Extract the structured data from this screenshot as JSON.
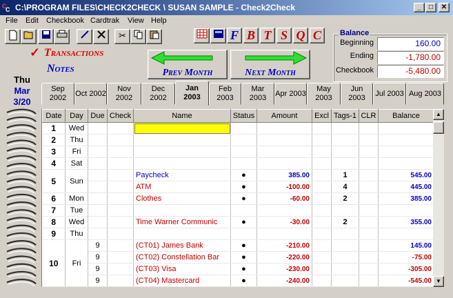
{
  "window": {
    "title": "C:\\PROGRAM FILES\\CHECK2CHECK \\ SUSAN SAMPLE - Check2Check",
    "min": "_",
    "max": "□",
    "close": "✕"
  },
  "menu": [
    "File",
    "Edit",
    "Checkbook",
    "Cardtrak",
    "View",
    "Help"
  ],
  "toolbar": {
    "new": "new-icon",
    "open": "open-icon",
    "save": "save-icon",
    "print": "print-icon",
    "pen": "pen-icon",
    "delete": "delete-icon",
    "cut": "scissors-icon",
    "copy": "copy-icon",
    "paste": "paste-icon"
  },
  "fbuttons": {
    "f": "F",
    "b": "B",
    "t": "T",
    "s": "S",
    "q": "Q",
    "c": "C"
  },
  "headings": {
    "transactions": "Transactions",
    "notes": "Notes",
    "check": "✓"
  },
  "calendar": {
    "dow": "Thu",
    "month": "Mar",
    "date": "3/20"
  },
  "nav": {
    "prev": "Prev Month",
    "next": "Next Month"
  },
  "balance": {
    "title": "Balance",
    "beginning_label": "Beginning",
    "beginning": "160.00",
    "ending_label": "Ending",
    "ending": "-1,780.00",
    "checkbook_label": "Checkbook",
    "checkbook": "-5,480.00"
  },
  "tabs": [
    "Sep 2002",
    "Oct 2002",
    "Nov\n2002",
    "Dec\n2002",
    "Jan\n2003",
    "Feb 2003",
    "Mar 2003",
    "Apr 2003",
    "May\n2003",
    "Jun 2003",
    "Jul 2003",
    "Aug 2003"
  ],
  "active_tab": 4,
  "columns": [
    "Date",
    "Day",
    "Due",
    "Check",
    "Name",
    "Status",
    "Amount",
    "Excl",
    "Tags-1",
    "CLR",
    "Balance"
  ],
  "rows": [
    {
      "date": "1",
      "day": "Wed"
    },
    {
      "date": "2",
      "day": "Thu"
    },
    {
      "date": "3",
      "day": "Fri"
    },
    {
      "date": "4",
      "day": "Sat"
    },
    {
      "date": "5",
      "day": "Sun",
      "items": [
        {
          "name": "Paycheck",
          "status": "●",
          "amount": "385.00",
          "tags": "1",
          "balance": "545.00",
          "color": "blue"
        },
        {
          "name": "ATM",
          "status": "●",
          "amount": "-100.00",
          "tags": "4",
          "balance": "445.00",
          "color": "red"
        }
      ]
    },
    {
      "date": "6",
      "day": "Mon",
      "items": [
        {
          "name": "Clothes",
          "status": "●",
          "amount": "-60.00",
          "tags": "2",
          "balance": "385.00",
          "color": "red"
        }
      ]
    },
    {
      "date": "7",
      "day": "Tue"
    },
    {
      "date": "8",
      "day": "Wed",
      "items": [
        {
          "name": "Time Warner Communic",
          "status": "●",
          "amount": "-30.00",
          "tags": "2",
          "balance": "355.00",
          "color": "red"
        }
      ]
    },
    {
      "date": "9",
      "day": "Thu"
    },
    {
      "date": "10",
      "day": "Fri",
      "items": [
        {
          "due": "9",
          "name": "(CT01) James Bank",
          "status": "●",
          "amount": "-210.00",
          "balance": "145.00",
          "color": "red",
          "balcolor": "blue"
        },
        {
          "due": "9",
          "name": "(CT02) Constellation Bar",
          "status": "●",
          "amount": "-220.00",
          "balance": "-75.00",
          "color": "red"
        },
        {
          "due": "9",
          "name": "(CT03) Visa",
          "status": "●",
          "amount": "-230.00",
          "balance": "-305.00",
          "color": "red"
        },
        {
          "due": "9",
          "name": "(CT04) Mastercard",
          "status": "●",
          "amount": "-240.00",
          "balance": "-545.00",
          "color": "red"
        }
      ]
    }
  ],
  "scroll": {
    "up": "▲",
    "down": "▼"
  }
}
